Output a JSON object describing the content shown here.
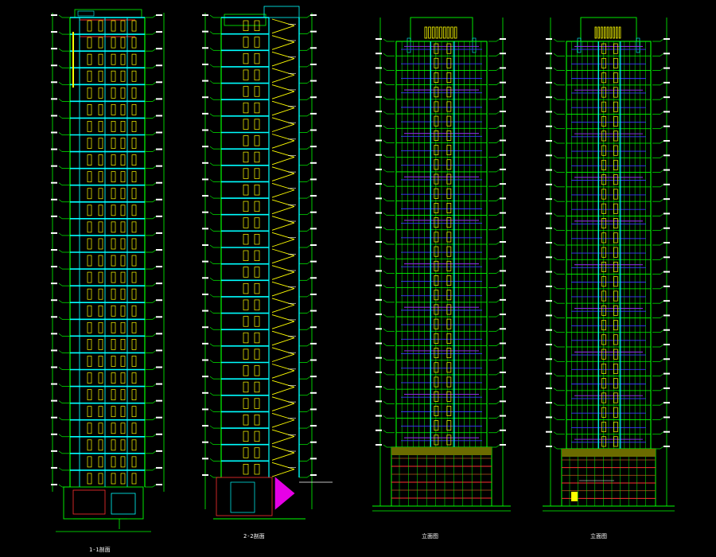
{
  "drawing": {
    "background": "#000000",
    "colors": {
      "structure": "#00ff00",
      "cyan": "#00ffff",
      "yellow": "#ffff00",
      "white": "#ffffff",
      "red": "#ff3030",
      "magenta": "#ff00ff",
      "blue": "#3a3aff",
      "purple": "#8a2be2",
      "olive": "#6b6b00",
      "brown": "#8b4513"
    },
    "floors_per_building": 28,
    "sheets": [
      {
        "kind": "section",
        "variant": "unit",
        "caption": "1-1剖面"
      },
      {
        "kind": "section",
        "variant": "stair",
        "caption": "2-2剖面"
      },
      {
        "kind": "elevation",
        "variant": "A",
        "caption": "立面图"
      },
      {
        "kind": "elevation",
        "variant": "B",
        "caption": "立面图"
      }
    ]
  }
}
